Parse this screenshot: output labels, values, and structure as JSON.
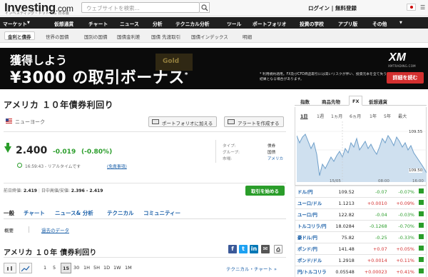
{
  "header": {
    "logo_main": "Investing",
    "logo_suffix": ".com",
    "logo_sub": "インベスティング・ドットコム 日本版",
    "search_placeholder": "ウェブサイトを検索...",
    "login": "ログイン | 無料登録"
  },
  "nav": {
    "items": [
      "マーケット",
      "仮想通貨",
      "チャート",
      "ニュース",
      "分析",
      "テクニカル分析",
      "ツール",
      "ポートフォリオ",
      "投資の学校",
      "アプリ版",
      "その他"
    ]
  },
  "subnav": {
    "active": "金利と債券",
    "items": [
      "世界の国債",
      "国別の国債",
      "国債金利差",
      "国債 先渡取引",
      "国債インデックス",
      "明細"
    ]
  },
  "banner": {
    "gold": "Gold",
    "line1": "獲得しよう",
    "line2": "¥3000 の取引ボーナス",
    "star": "*",
    "brand": "XM",
    "brand_sub": "XMTRADING.COM",
    "note": "* 利用規約適用。FX及びCFD商品取引には高いリスクが伴い、投資元本を全て失う結果となる場合があります。",
    "cta": "詳細を読む"
  },
  "instrument": {
    "title": "アメリカ １０年債券利回り",
    "location": "ニューヨーク",
    "btn_portfolio": "ポートフォリオに加える",
    "btn_alert": "アラートを作成する",
    "last": "2.400",
    "change": "-0.019",
    "change_pct": "(-0.80%)",
    "realtime": "16:59:43 - リアルタイムです",
    "disclaimer": "(免責事項)",
    "info": [
      {
        "k": "タイプ:",
        "v": "債券"
      },
      {
        "k": "グループ:",
        "v": "国債"
      },
      {
        "k": "市場:",
        "v": "アメリカ"
      }
    ],
    "prev_close_label": "前日終値:",
    "prev_close": "2.419",
    "range_label": "日中高値/安値:",
    "range": "2.396 - 2.419",
    "trade_btn": "取引を始める"
  },
  "tabs": {
    "items": [
      "一般",
      "チャート",
      "ニュース& 分析",
      "テクニカル",
      "コミュニティー"
    ],
    "sub_overview": "概要",
    "sub_hist": "過去のデータ"
  },
  "chart_section": {
    "title": "アメリカ １０年 債券利回り",
    "periods": [
      "1",
      "5",
      "15",
      "30",
      "1H",
      "5H",
      "1D",
      "1W",
      "1M"
    ],
    "tech_link": "テクニカル・チャート »"
  },
  "sidebar": {
    "tabs": [
      "指数",
      "商品先物",
      "FX",
      "仮想通貨"
    ],
    "periods": [
      "1日",
      "1週",
      "1ヵ月",
      "6ヵ月",
      "1年",
      "5年",
      "最大"
    ],
    "chart_ymax": "109.55",
    "chart_ymin": "109.50",
    "chart_x": [
      "15/05",
      "08:00",
      "16:00"
    ],
    "fx": [
      {
        "pair": "ドル/円",
        "last": "109.52",
        "chg": "-0.07",
        "pct": "-0.07%",
        "dir": "down"
      },
      {
        "pair": "ユーロ/ドル",
        "last": "1.1213",
        "chg": "+0.0010",
        "pct": "+0.09%",
        "dir": "up"
      },
      {
        "pair": "ユーロ/円",
        "last": "122.82",
        "chg": "-0.04",
        "pct": "-0.03%",
        "dir": "down"
      },
      {
        "pair": "トルコリラ/円",
        "last": "18.0284",
        "chg": "-0.1268",
        "pct": "-0.70%",
        "dir": "down"
      },
      {
        "pair": "豪ドル/円",
        "last": "75.82",
        "chg": "-0.25",
        "pct": "-0.33%",
        "dir": "down"
      },
      {
        "pair": "ポンド/円",
        "last": "141.48",
        "chg": "+0.07",
        "pct": "+0.05%",
        "dir": "up"
      },
      {
        "pair": "ポンド/ドル",
        "last": "1.2918",
        "chg": "+0.0014",
        "pct": "+0.11%",
        "dir": "up"
      },
      {
        "pair": "円/トルコリラ",
        "last": "0.05548",
        "chg": "+0.00023",
        "pct": "+0.41%",
        "dir": "up"
      }
    ]
  }
}
